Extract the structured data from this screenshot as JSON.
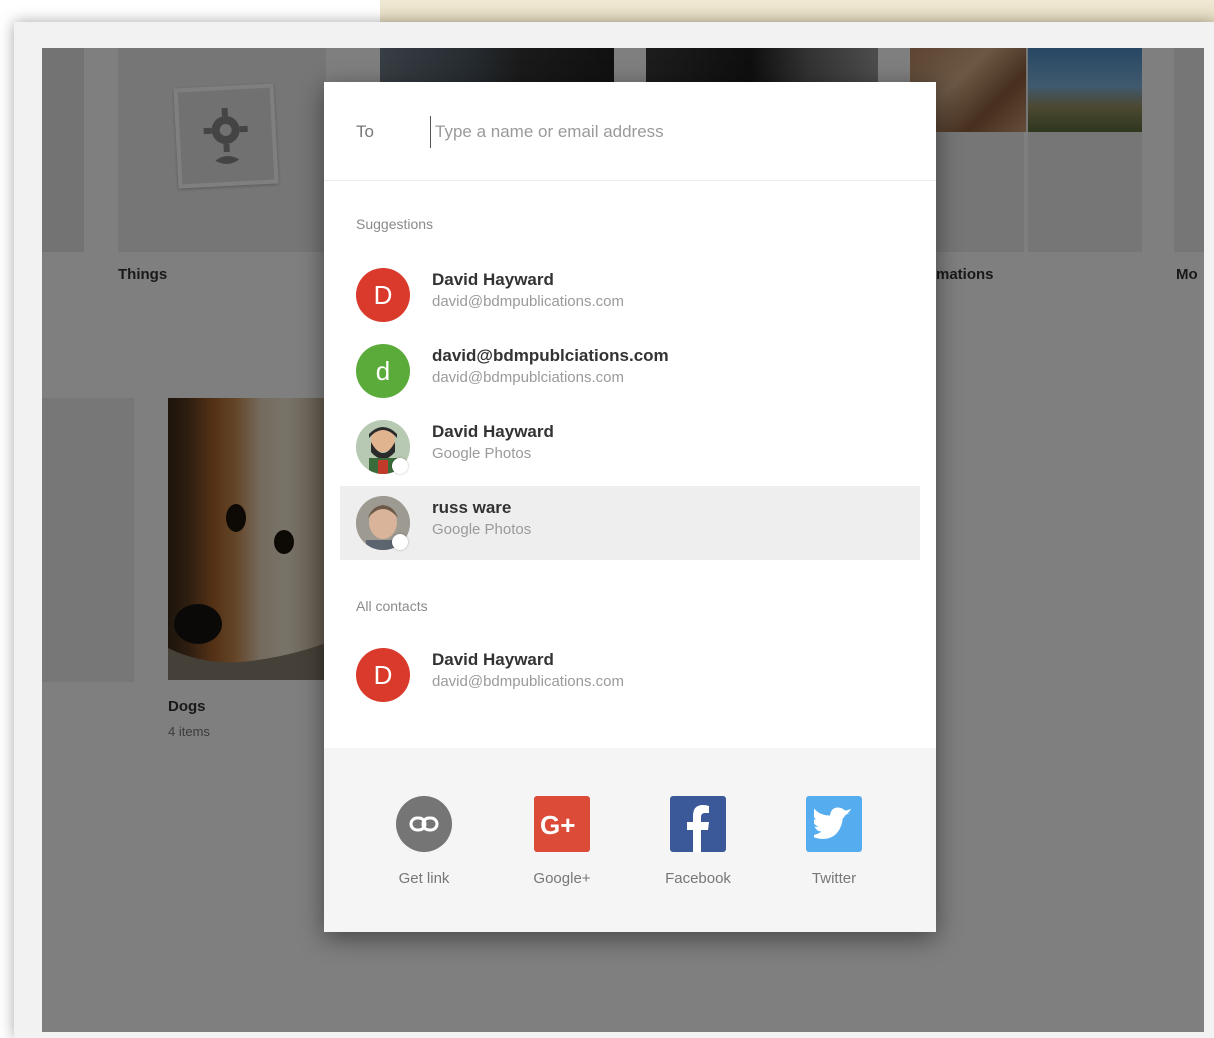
{
  "gallery": {
    "things_label": "Things",
    "animations_label": "mations",
    "more_label": "Mo",
    "dogs_label": "Dogs",
    "dogs_count": "4 items"
  },
  "share": {
    "to_label": "To",
    "to_placeholder": "Type a name or email address",
    "suggestions_heading": "Suggestions",
    "all_contacts_heading": "All contacts",
    "suggestions": [
      {
        "initial": "D",
        "name": "David Hayward",
        "sub": "david@bdmpublications.com",
        "color": "#d93a2b"
      },
      {
        "initial": "d",
        "name": "david@bdmpublciations.com",
        "sub": "david@bdmpublciations.com",
        "color": "#5aab3a"
      },
      {
        "name": "David Hayward",
        "sub": "Google Photos",
        "avatar": "cartoon-photo"
      },
      {
        "name": "russ ware",
        "sub": "Google Photos",
        "avatar": "person-photo",
        "highlighted": true
      }
    ],
    "all_contacts": [
      {
        "initial": "D",
        "name": "David Hayward",
        "sub": "david@bdmpublications.com",
        "color": "#d93a2b"
      }
    ],
    "targets": [
      {
        "label": "Get link",
        "icon": "link-icon",
        "color": "#757575"
      },
      {
        "label": "Google+",
        "icon": "google-plus-icon",
        "color": "#dc4a38"
      },
      {
        "label": "Facebook",
        "icon": "facebook-icon",
        "color": "#3b5998"
      },
      {
        "label": "Twitter",
        "icon": "twitter-icon",
        "color": "#55acee"
      }
    ]
  }
}
